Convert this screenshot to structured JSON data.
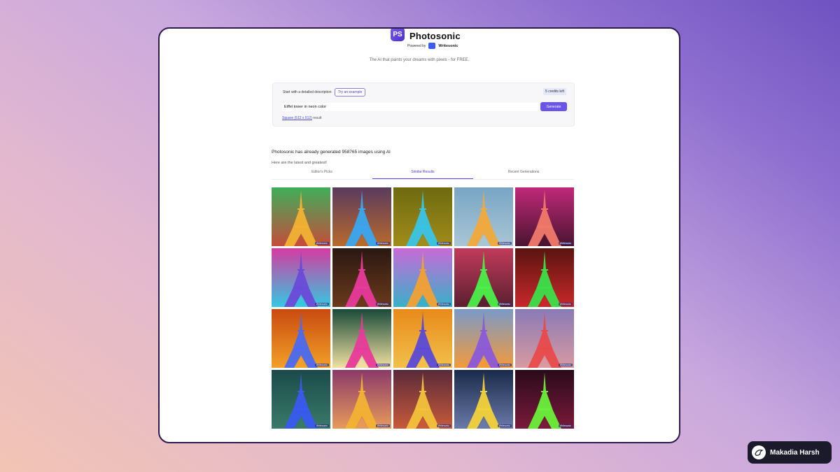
{
  "app": {
    "logo_text": "PS",
    "name": "Photosonic",
    "powered_by": "Powered by",
    "partner": "Writesonic",
    "tagline": "The AI that paints your dreams with pixels - for FREE."
  },
  "prompt": {
    "label": "Start with a detailed description",
    "try_example": "Try an example",
    "credits": "5 credits left",
    "value": "Eiffel tower in neon color",
    "generate": "Generate",
    "size_link": "Square (512 x 512)",
    "size_suffix": "result"
  },
  "stats": {
    "title": "Photosonic has already generated 958765 images using AI",
    "subtitle": "Here are the latest and greatest!"
  },
  "tabs": [
    {
      "label": "Editor's Picks",
      "active": false
    },
    {
      "label": "Similar Results",
      "active": true
    },
    {
      "label": "Recent Generations",
      "active": false
    }
  ],
  "watermark": "Writesonic",
  "gallery": [
    {
      "bg1": "#3fae5a",
      "bg2": "#c44d3a",
      "tower": "#f2b233"
    },
    {
      "bg1": "#5a3a5e",
      "bg2": "#b86a2c",
      "tower": "#3aa6f0"
    },
    {
      "bg1": "#6e6a10",
      "bg2": "#a08c1a",
      "tower": "#38c4e8"
    },
    {
      "bg1": "#79a5c4",
      "bg2": "#a8c6d4",
      "tower": "#f2a93a"
    },
    {
      "bg1": "#c0287a",
      "bg2": "#4a1430",
      "tower": "#f07a6a"
    },
    {
      "bg1": "#d63aa0",
      "bg2": "#34c8e0",
      "tower": "#6a4ad8"
    },
    {
      "bg1": "#2a1812",
      "bg2": "#6a3a1c",
      "tower": "#e83a9a"
    },
    {
      "bg1": "#c86ad8",
      "bg2": "#38b0c8",
      "tower": "#f2a033"
    },
    {
      "bg1": "#c23a5a",
      "bg2": "#5a2030",
      "tower": "#4af04a"
    },
    {
      "bg1": "#5a1410",
      "bg2": "#c8282a",
      "tower": "#3ae04a"
    },
    {
      "bg1": "#c84a10",
      "bg2": "#f2a028",
      "tower": "#4a6af0"
    },
    {
      "bg1": "#1a4a3a",
      "bg2": "#f0e0a0",
      "tower": "#e83a9a"
    },
    {
      "bg1": "#e88a1a",
      "bg2": "#f2c04a",
      "tower": "#5a4ad8"
    },
    {
      "bg1": "#7a9ac8",
      "bg2": "#f29a3a",
      "tower": "#8a5ad8"
    },
    {
      "bg1": "#8a7ab8",
      "bg2": "#d89aa0",
      "tower": "#e84a4a"
    },
    {
      "bg1": "#1a4a4a",
      "bg2": "#3a7a6a",
      "tower": "#3a5af0"
    },
    {
      "bg1": "#8a3a6a",
      "bg2": "#e89a5a",
      "tower": "#f2b233"
    },
    {
      "bg1": "#5a2a3a",
      "bg2": "#c85a3a",
      "tower": "#f2c23a"
    },
    {
      "bg1": "#1a2a4a",
      "bg2": "#6a7aa8",
      "tower": "#f2d23a"
    },
    {
      "bg1": "#2a0a1a",
      "bg2": "#7a1a3a",
      "tower": "#6af03a"
    }
  ],
  "author": {
    "name": "Makadia Harsh"
  }
}
